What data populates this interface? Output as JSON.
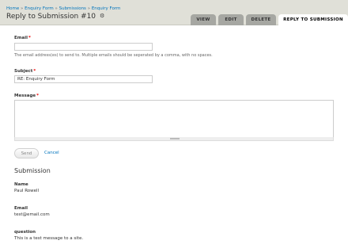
{
  "breadcrumb": [
    {
      "label": "Home"
    },
    {
      "label": "Enquiry Form"
    },
    {
      "label": "Submissions"
    },
    {
      "label": "Enquiry Form"
    }
  ],
  "breadcrumb_separator": "»",
  "page_title": "Reply to Submission #10",
  "tabs": [
    {
      "label": "VIEW"
    },
    {
      "label": "EDIT"
    },
    {
      "label": "DELETE"
    },
    {
      "label": "REPLY TO SUBMISSION",
      "active": true
    }
  ],
  "form": {
    "email": {
      "label": "Email",
      "required_mark": "*",
      "value": "",
      "description": "The email address(es) to send to. Multiple emails should be seperated by a comma, with no spaces."
    },
    "subject": {
      "label": "Subject",
      "required_mark": "*",
      "value": "RE: Enquiry Form"
    },
    "message": {
      "label": "Message",
      "required_mark": "*",
      "value": ""
    },
    "send_label": "Send",
    "cancel_label": "Cancel"
  },
  "submission": {
    "title": "Submission",
    "fields": [
      {
        "label": "Name",
        "value": "Paul Rowell"
      },
      {
        "label": "Email",
        "value": "test@email.com"
      },
      {
        "label": "question",
        "value": "This is a test message to a site."
      }
    ]
  },
  "colors": {
    "link": "#0074bd",
    "required": "#ee0000",
    "header_bg": "#e0e0d8",
    "tab_bg": "#a6a7a2"
  },
  "icons": {
    "title_action": "gear-icon"
  }
}
